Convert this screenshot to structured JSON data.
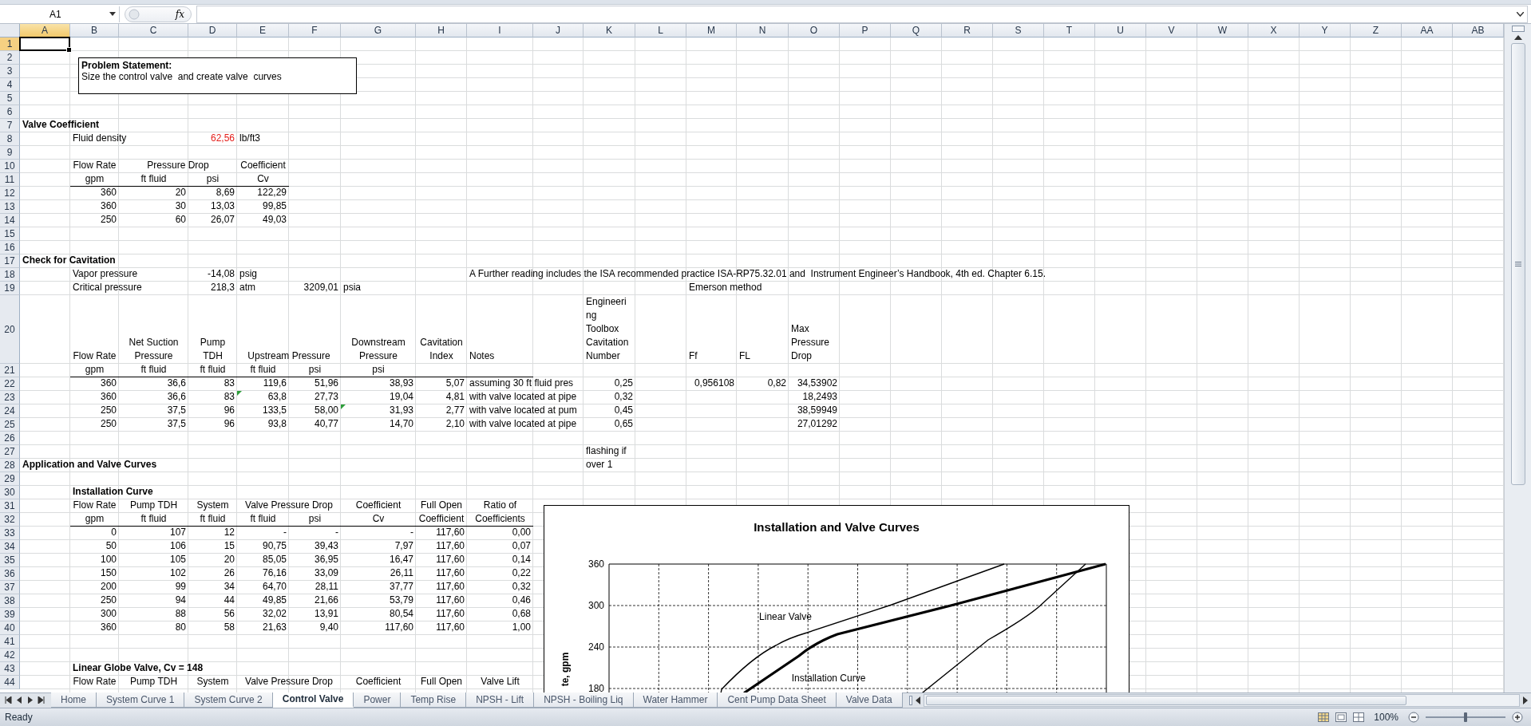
{
  "formula_bar": {
    "name_box": "A1",
    "fx_label": "fx"
  },
  "sheet": {
    "columns": [
      {
        "label": "A",
        "selected": true
      },
      {
        "label": "B",
        "selected": false
      },
      {
        "label": "C",
        "selected": false
      },
      {
        "label": "D",
        "selected": false
      },
      {
        "label": "E",
        "selected": false
      },
      {
        "label": "F",
        "selected": false
      },
      {
        "label": "G",
        "selected": false
      },
      {
        "label": "H",
        "selected": false
      },
      {
        "label": "I",
        "selected": false
      },
      {
        "label": "J",
        "selected": false
      },
      {
        "label": "K",
        "selected": false
      },
      {
        "label": "L",
        "selected": false
      },
      {
        "label": "M",
        "selected": false
      },
      {
        "label": "N",
        "selected": false
      },
      {
        "label": "O",
        "selected": false
      },
      {
        "label": "P",
        "selected": false
      },
      {
        "label": "Q",
        "selected": false
      },
      {
        "label": "R",
        "selected": false
      },
      {
        "label": "S",
        "selected": false
      },
      {
        "label": "T",
        "selected": false
      },
      {
        "label": "U",
        "selected": false
      },
      {
        "label": "V",
        "selected": false
      },
      {
        "label": "W",
        "selected": false
      },
      {
        "label": "X",
        "selected": false
      },
      {
        "label": "Y",
        "selected": false
      },
      {
        "label": "Z",
        "selected": false
      },
      {
        "label": "AA",
        "selected": false
      },
      {
        "label": "AB",
        "selected": false
      }
    ],
    "rows": [
      {
        "label": "1",
        "selected": true
      },
      {
        "label": "2",
        "selected": false
      },
      {
        "label": "3",
        "selected": false
      },
      {
        "label": "4",
        "selected": false
      },
      {
        "label": "5",
        "selected": false
      },
      {
        "label": "6",
        "selected": false
      },
      {
        "label": "7",
        "selected": false,
        "cells": {
          "A": {
            "text": "Valve Coefficient",
            "kind": "heading"
          }
        }
      },
      {
        "label": "8",
        "selected": false,
        "cells": {
          "B": {
            "text": "Fluid density",
            "kind": "label"
          },
          "D": {
            "text": "62,56",
            "kind": "input"
          },
          "E": {
            "text": "lb/ft3",
            "kind": "label"
          }
        }
      },
      {
        "label": "9",
        "selected": false
      },
      {
        "label": "10",
        "selected": false,
        "cells": {
          "B": {
            "text": "Flow Rate",
            "kind": "header"
          },
          "C": {
            "text": "Pressure Drop",
            "kind": "header",
            "wide": true
          },
          "E": {
            "text": "Coefficient",
            "kind": "header"
          }
        }
      },
      {
        "label": "11",
        "selected": false,
        "underlined": true,
        "cells": {
          "B": {
            "text": "gpm",
            "kind": "header"
          },
          "C": {
            "text": "ft fluid",
            "kind": "header"
          },
          "D": {
            "text": "psi",
            "kind": "header"
          },
          "E": {
            "text": "Cv",
            "kind": "header"
          }
        }
      },
      {
        "label": "12",
        "selected": false,
        "cells": {
          "B": {
            "text": "360",
            "kind": "number"
          },
          "C": {
            "text": "20",
            "kind": "number"
          },
          "D": {
            "text": "8,69",
            "kind": "number"
          },
          "E": {
            "text": "122,29",
            "kind": "number"
          }
        }
      },
      {
        "label": "13",
        "selected": false,
        "cells": {
          "B": {
            "text": "360",
            "kind": "number"
          },
          "C": {
            "text": "30",
            "kind": "number"
          },
          "D": {
            "text": "13,03",
            "kind": "number"
          },
          "E": {
            "text": "99,85",
            "kind": "number"
          }
        }
      },
      {
        "label": "14",
        "selected": false,
        "cells": {
          "B": {
            "text": "250",
            "kind": "number"
          },
          "C": {
            "text": "60",
            "kind": "number"
          },
          "D": {
            "text": "26,07",
            "kind": "number"
          },
          "E": {
            "text": "49,03",
            "kind": "number"
          }
        }
      },
      {
        "label": "15",
        "selected": false
      },
      {
        "label": "16",
        "selected": false
      },
      {
        "label": "17",
        "selected": false,
        "cells": {
          "A": {
            "text": "Check for Cavitation",
            "kind": "heading"
          }
        }
      },
      {
        "label": "18",
        "selected": false,
        "cells": {
          "B": {
            "text": "Vapor pressure",
            "kind": "label"
          },
          "D": {
            "text": "-14,08",
            "kind": "number"
          },
          "E": {
            "text": "psig",
            "kind": "label"
          },
          "I": {
            "text": "A Further reading includes the ISA recommended practice ISA-RP75.32.01 and  Instrument Engineer’s Handbook, 4th ed. Chapter 6.15.",
            "kind": "label"
          }
        }
      },
      {
        "label": "19",
        "selected": false,
        "cells": {
          "B": {
            "text": "Critical pressure",
            "kind": "label"
          },
          "D": {
            "text": "218,3",
            "kind": "number"
          },
          "E": {
            "text": "atm",
            "kind": "label"
          },
          "F": {
            "text": "3209,01",
            "kind": "number"
          },
          "G": {
            "text": "psia",
            "kind": "label"
          },
          "M": {
            "text": "Emerson method",
            "kind": "label"
          }
        }
      },
      {
        "label": "20",
        "selected": false,
        "cells": {
          "B": {
            "text": "Flow Rate",
            "kind": "header"
          },
          "C": {
            "text": "Net Suction\nPressure",
            "kind": "header"
          },
          "D": {
            "text": "Pump\nTDH",
            "kind": "header"
          },
          "E": {
            "text": "Upstream Pressure",
            "kind": "header",
            "wide": true
          },
          "G": {
            "text": "Downstream\nPressure",
            "kind": "header"
          },
          "H": {
            "text": "Cavitation\nIndex",
            "kind": "header"
          },
          "I": {
            "text": "Notes",
            "kind": "label"
          },
          "K": {
            "text": "Engineeri\nng\nToolbox\nCavitation\nNumber",
            "kind": "label"
          },
          "M": {
            "text": "Ff",
            "kind": "label"
          },
          "N": {
            "text": "FL",
            "kind": "label"
          },
          "O": {
            "text": "Max\nPressure\nDrop",
            "kind": "label"
          }
        }
      },
      {
        "label": "21",
        "selected": false,
        "underlined": true,
        "cells": {
          "B": {
            "text": "gpm",
            "kind": "header"
          },
          "C": {
            "text": "ft fluid",
            "kind": "header"
          },
          "D": {
            "text": "ft fluid",
            "kind": "header"
          },
          "E": {
            "text": "ft fluid",
            "kind": "header"
          },
          "F": {
            "text": "psi",
            "kind": "header"
          },
          "G": {
            "text": "psi",
            "kind": "header"
          }
        }
      },
      {
        "label": "22",
        "selected": false,
        "cells": {
          "B": {
            "text": "360",
            "kind": "number"
          },
          "C": {
            "text": "36,6",
            "kind": "number"
          },
          "D": {
            "text": "83",
            "kind": "number"
          },
          "E": {
            "text": "119,6",
            "kind": "number"
          },
          "F": {
            "text": "51,96",
            "kind": "number"
          },
          "G": {
            "text": "38,93",
            "kind": "number"
          },
          "H": {
            "text": "5,07",
            "kind": "number"
          },
          "I": {
            "text": "assuming 30 ft fluid pres",
            "kind": "label"
          },
          "K": {
            "text": "0,25",
            "kind": "number"
          },
          "M": {
            "text": "0,956108",
            "kind": "number"
          },
          "N": {
            "text": "0,82",
            "kind": "number"
          },
          "O": {
            "text": "34,53902",
            "kind": "number"
          }
        }
      },
      {
        "label": "23",
        "selected": false,
        "cells": {
          "B": {
            "text": "360",
            "kind": "number"
          },
          "C": {
            "text": "36,6",
            "kind": "number"
          },
          "D": {
            "text": "83",
            "kind": "number"
          },
          "E": {
            "text": "63,8",
            "kind": "number",
            "flagged": true
          },
          "F": {
            "text": "27,73",
            "kind": "number"
          },
          "G": {
            "text": "19,04",
            "kind": "number"
          },
          "H": {
            "text": "4,81",
            "kind": "number"
          },
          "I": {
            "text": "with valve located at pipe",
            "kind": "label"
          },
          "K": {
            "text": "0,32",
            "kind": "number"
          },
          "O": {
            "text": "18,2493",
            "kind": "number"
          }
        }
      },
      {
        "label": "24",
        "selected": false,
        "cells": {
          "B": {
            "text": "250",
            "kind": "number"
          },
          "C": {
            "text": "37,5",
            "kind": "number"
          },
          "D": {
            "text": "96",
            "kind": "number"
          },
          "E": {
            "text": "133,5",
            "kind": "number"
          },
          "F": {
            "text": "58,00",
            "kind": "number"
          },
          "G": {
            "text": "31,93",
            "kind": "number",
            "flagged": true
          },
          "H": {
            "text": "2,77",
            "kind": "number"
          },
          "I": {
            "text": "with valve located at pum",
            "kind": "label"
          },
          "K": {
            "text": "0,45",
            "kind": "number"
          },
          "O": {
            "text": "38,59949",
            "kind": "number"
          }
        }
      },
      {
        "label": "25",
        "selected": false,
        "cells": {
          "B": {
            "text": "250",
            "kind": "number"
          },
          "C": {
            "text": "37,5",
            "kind": "number"
          },
          "D": {
            "text": "96",
            "kind": "number"
          },
          "E": {
            "text": "93,8",
            "kind": "number"
          },
          "F": {
            "text": "40,77",
            "kind": "number"
          },
          "G": {
            "text": "14,70",
            "kind": "number"
          },
          "H": {
            "text": "2,10",
            "kind": "number"
          },
          "I": {
            "text": "with valve located at pipe",
            "kind": "label"
          },
          "K": {
            "text": "0,65",
            "kind": "number"
          },
          "O": {
            "text": "27,01292",
            "kind": "number"
          }
        }
      },
      {
        "label": "26",
        "selected": false
      },
      {
        "label": "27",
        "selected": false,
        "cells": {
          "K": {
            "text": "flashing if\nover 1",
            "kind": "label",
            "tall": true
          }
        }
      },
      {
        "label": "28",
        "selected": false,
        "cells": {
          "A": {
            "text": "Application and Valve Curves",
            "kind": "heading"
          }
        }
      },
      {
        "label": "29",
        "selected": false
      },
      {
        "label": "30",
        "selected": false,
        "cells": {
          "B": {
            "text": "Installation Curve",
            "kind": "heading"
          }
        }
      },
      {
        "label": "31",
        "selected": false,
        "cells": {
          "B": {
            "text": "Flow Rate",
            "kind": "header"
          },
          "C": {
            "text": "Pump TDH",
            "kind": "header"
          },
          "D": {
            "text": "System",
            "kind": "header"
          },
          "E": {
            "text": "Valve Pressure Drop",
            "kind": "header",
            "wide": true
          },
          "G": {
            "text": "Coefficient",
            "kind": "header"
          },
          "H": {
            "text": "Full Open",
            "kind": "header"
          },
          "I": {
            "text": "Ratio of",
            "kind": "header"
          }
        }
      },
      {
        "label": "32",
        "selected": false,
        "underlined": true,
        "cells": {
          "B": {
            "text": "gpm",
            "kind": "header"
          },
          "C": {
            "text": "ft fluid",
            "kind": "header"
          },
          "D": {
            "text": "ft fluid",
            "kind": "header"
          },
          "E": {
            "text": "ft fluid",
            "kind": "header"
          },
          "F": {
            "text": "psi",
            "kind": "header"
          },
          "G": {
            "text": "Cv",
            "kind": "header"
          },
          "H": {
            "text": "Coefficient",
            "kind": "header"
          },
          "I": {
            "text": "Coefficients",
            "kind": "header"
          }
        }
      },
      {
        "label": "33",
        "selected": false,
        "cells": {
          "B": {
            "text": "0",
            "kind": "number"
          },
          "C": {
            "text": "107",
            "kind": "number"
          },
          "D": {
            "text": "12",
            "kind": "number"
          },
          "E": {
            "text": "-",
            "kind": "number"
          },
          "F": {
            "text": "-",
            "kind": "number"
          },
          "G": {
            "text": "-",
            "kind": "number"
          },
          "H": {
            "text": "117,60",
            "kind": "number"
          },
          "I": {
            "text": "0,00",
            "kind": "number"
          }
        }
      },
      {
        "label": "34",
        "selected": false,
        "cells": {
          "B": {
            "text": "50",
            "kind": "number"
          },
          "C": {
            "text": "106",
            "kind": "number"
          },
          "D": {
            "text": "15",
            "kind": "number"
          },
          "E": {
            "text": "90,75",
            "kind": "number"
          },
          "F": {
            "text": "39,43",
            "kind": "number"
          },
          "G": {
            "text": "7,97",
            "kind": "number"
          },
          "H": {
            "text": "117,60",
            "kind": "number"
          },
          "I": {
            "text": "0,07",
            "kind": "number"
          }
        }
      },
      {
        "label": "35",
        "selected": false,
        "cells": {
          "B": {
            "text": "100",
            "kind": "number"
          },
          "C": {
            "text": "105",
            "kind": "number"
          },
          "D": {
            "text": "20",
            "kind": "number"
          },
          "E": {
            "text": "85,05",
            "kind": "number"
          },
          "F": {
            "text": "36,95",
            "kind": "number"
          },
          "G": {
            "text": "16,47",
            "kind": "number"
          },
          "H": {
            "text": "117,60",
            "kind": "number"
          },
          "I": {
            "text": "0,14",
            "kind": "number"
          }
        }
      },
      {
        "label": "36",
        "selected": false,
        "cells": {
          "B": {
            "text": "150",
            "kind": "number"
          },
          "C": {
            "text": "102",
            "kind": "number"
          },
          "D": {
            "text": "26",
            "kind": "number"
          },
          "E": {
            "text": "76,16",
            "kind": "number"
          },
          "F": {
            "text": "33,09",
            "kind": "number"
          },
          "G": {
            "text": "26,11",
            "kind": "number"
          },
          "H": {
            "text": "117,60",
            "kind": "number"
          },
          "I": {
            "text": "0,22",
            "kind": "number"
          }
        }
      },
      {
        "label": "37",
        "selected": false,
        "cells": {
          "B": {
            "text": "200",
            "kind": "number"
          },
          "C": {
            "text": "99",
            "kind": "number"
          },
          "D": {
            "text": "34",
            "kind": "number"
          },
          "E": {
            "text": "64,70",
            "kind": "number"
          },
          "F": {
            "text": "28,11",
            "kind": "number"
          },
          "G": {
            "text": "37,77",
            "kind": "number"
          },
          "H": {
            "text": "117,60",
            "kind": "number"
          },
          "I": {
            "text": "0,32",
            "kind": "number"
          }
        }
      },
      {
        "label": "38",
        "selected": false,
        "cells": {
          "B": {
            "text": "250",
            "kind": "number"
          },
          "C": {
            "text": "94",
            "kind": "number"
          },
          "D": {
            "text": "44",
            "kind": "number"
          },
          "E": {
            "text": "49,85",
            "kind": "number"
          },
          "F": {
            "text": "21,66",
            "kind": "number"
          },
          "G": {
            "text": "53,79",
            "kind": "number"
          },
          "H": {
            "text": "117,60",
            "kind": "number"
          },
          "I": {
            "text": "0,46",
            "kind": "number"
          }
        }
      },
      {
        "label": "39",
        "selected": false,
        "cells": {
          "B": {
            "text": "300",
            "kind": "number"
          },
          "C": {
            "text": "88",
            "kind": "number"
          },
          "D": {
            "text": "56",
            "kind": "number"
          },
          "E": {
            "text": "32,02",
            "kind": "number"
          },
          "F": {
            "text": "13,91",
            "kind": "number"
          },
          "G": {
            "text": "80,54",
            "kind": "number"
          },
          "H": {
            "text": "117,60",
            "kind": "number"
          },
          "I": {
            "text": "0,68",
            "kind": "number"
          }
        }
      },
      {
        "label": "40",
        "selected": false,
        "cells": {
          "B": {
            "text": "360",
            "kind": "number"
          },
          "C": {
            "text": "80",
            "kind": "number"
          },
          "D": {
            "text": "58",
            "kind": "number"
          },
          "E": {
            "text": "21,63",
            "kind": "number"
          },
          "F": {
            "text": "9,40",
            "kind": "number"
          },
          "G": {
            "text": "117,60",
            "kind": "number"
          },
          "H": {
            "text": "117,60",
            "kind": "number"
          },
          "I": {
            "text": "1,00",
            "kind": "number"
          }
        }
      },
      {
        "label": "41",
        "selected": false
      },
      {
        "label": "42",
        "selected": false
      },
      {
        "label": "43",
        "selected": false,
        "cells": {
          "B": {
            "text": "Linear Globe Valve, Cv = 148",
            "kind": "heading"
          }
        }
      },
      {
        "label": "44",
        "selected": false,
        "cells": {
          "B": {
            "text": "Flow Rate",
            "kind": "header"
          },
          "C": {
            "text": "Pump TDH",
            "kind": "header"
          },
          "D": {
            "text": "System",
            "kind": "header"
          },
          "E": {
            "text": "Valve Pressure Drop",
            "kind": "header",
            "wide": true
          },
          "G": {
            "text": "Coefficient",
            "kind": "header"
          },
          "H": {
            "text": "Full Open",
            "kind": "header"
          },
          "I": {
            "text": "Valve Lift",
            "kind": "header"
          }
        }
      }
    ]
  },
  "text_box": {
    "title": "Problem Statement:",
    "text": "Size the control valve  and create valve  curves"
  },
  "chart": {
    "title": "Installation and Valve Curves",
    "y_ticks": [
      "360",
      "300",
      "240",
      "180"
    ],
    "ylabel": "te, gpm",
    "curve_labels": [
      "Linear Valve",
      "Installation Curve"
    ]
  },
  "sheet_tabs": [
    {
      "label": "Home",
      "selected": false
    },
    {
      "label": "System Curve 1",
      "selected": false
    },
    {
      "label": "System Curve 2",
      "selected": false
    },
    {
      "label": "Control Valve",
      "selected": true
    },
    {
      "label": "Power",
      "selected": false
    },
    {
      "label": "Temp Rise",
      "selected": false
    },
    {
      "label": "NPSH - Lift",
      "selected": false
    },
    {
      "label": "NPSH - Boiling Liq",
      "selected": false
    },
    {
      "label": "Water Hammer",
      "selected": false
    },
    {
      "label": "Cent Pump Data Sheet",
      "selected": false
    },
    {
      "label": "Valve Data",
      "selected": false
    }
  ],
  "status_bar": {
    "status": "Ready",
    "zoom": "100%",
    "zoom_level": {
      "level": 0.5
    }
  }
}
